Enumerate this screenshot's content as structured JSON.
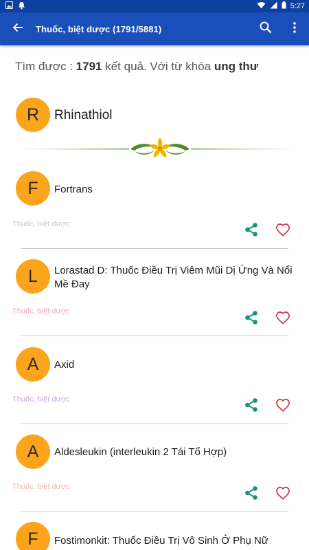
{
  "status_bar": {
    "time": "5:27"
  },
  "app_bar": {
    "title": "Thuốc, biệt dược (1791/5881)"
  },
  "summary": {
    "prefix": "Tìm được : ",
    "count": "1791",
    "middle": " kết quả. Với từ khóa ",
    "keyword": "ung thư"
  },
  "featured": {
    "letter": "R",
    "title": "Rhinathiol"
  },
  "items": [
    {
      "letter": "F",
      "title": "Fortrans",
      "category": "Thuốc, biệt dược",
      "category_color": "#c9c9c9"
    },
    {
      "letter": "L",
      "title": "Lorastad D: Thuốc Điều Trị Viêm Mũi Dị Ứng Và Nổi Mề Đay",
      "category": "Thuốc, biệt dược",
      "category_color": "#f5a3c0"
    },
    {
      "letter": "A",
      "title": "Axid",
      "category": "Thuốc, biệt dược",
      "category_color": "#c9a7dd"
    },
    {
      "letter": "A",
      "title": "Aldesleukin (interleukin 2 Tái Tổ Hợp)",
      "category": "Thuốc, biệt dược",
      "category_color": "#f3b5b5"
    },
    {
      "letter": "F",
      "title": "Fostimonkit: Thuốc Điều Trị Vô Sinh Ở Phụ Nữ"
    }
  ],
  "colors": {
    "app_bar": "#1a4eb8",
    "status_bar": "#0d3f9c",
    "avatar": "#fca41c",
    "share_icon": "#16937e",
    "favorite_icon": "#d62f3a"
  },
  "icons": {
    "back": "arrow-left-icon",
    "search": "search-icon",
    "more": "more-vertical-icon",
    "share": "share-icon",
    "favorite": "heart-outline-icon"
  }
}
